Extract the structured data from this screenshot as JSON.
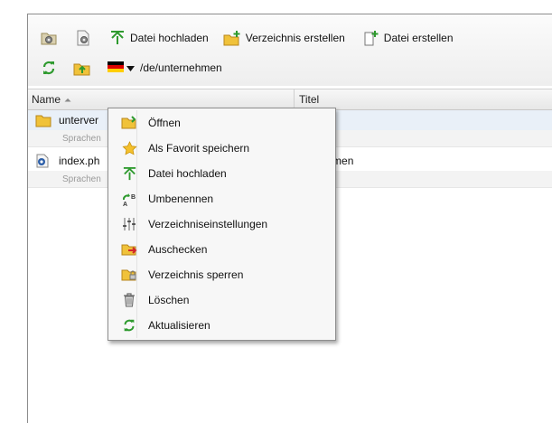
{
  "toolbar": {
    "upload_label": "Datei hochladen",
    "create_dir_label": "Verzeichnis erstellen",
    "create_file_label": "Datei erstellen",
    "path_value": "/de/unternehmen"
  },
  "grid": {
    "col_name": "Name",
    "col_title": "Titel",
    "rows": [
      {
        "name": "unterver",
        "title": "",
        "sub": "Sprachen",
        "icon": "folder-icon"
      },
      {
        "name": "index.ph",
        "title": "ternehmen",
        "sub": "Sprachen",
        "icon": "php-file-icon"
      }
    ]
  },
  "context_menu": {
    "items": [
      {
        "label": "Öffnen",
        "icon": "folder-open-icon"
      },
      {
        "label": "Als Favorit speichern",
        "icon": "star-icon"
      },
      {
        "label": "Datei hochladen",
        "icon": "upload-icon"
      },
      {
        "label": "Umbenennen",
        "icon": "rename-icon"
      },
      {
        "label": "Verzeichniseinstellungen",
        "icon": "settings-sliders-icon"
      },
      {
        "label": "Auschecken",
        "icon": "checkout-folder-icon"
      },
      {
        "label": "Verzeichnis sperren",
        "icon": "lock-folder-icon"
      },
      {
        "label": "Löschen",
        "icon": "trash-icon"
      },
      {
        "label": "Aktualisieren",
        "icon": "refresh-icon"
      }
    ]
  },
  "colors": {
    "accent_green": "#2e9a2e",
    "folder_yellow": "#f0c23a",
    "selected_row": "#e9f0f8"
  }
}
